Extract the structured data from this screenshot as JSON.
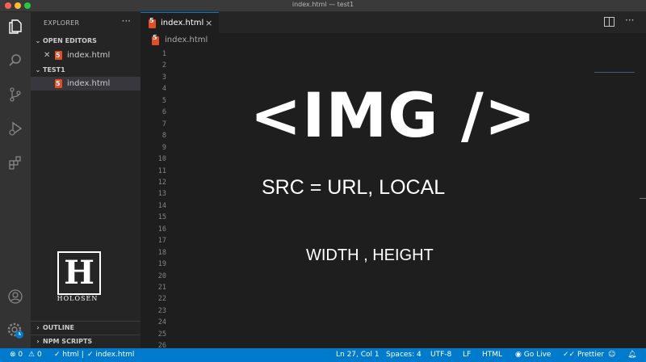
{
  "window": {
    "title": "index.html — test1"
  },
  "activity_bar": {
    "icons": [
      "explorer-icon",
      "search-icon",
      "source-control-icon",
      "run-debug-icon",
      "extensions-icon",
      "account-icon",
      "settings-gear-icon"
    ]
  },
  "sidebar": {
    "header": "EXPLORER",
    "more": "···",
    "open_editors": {
      "label": "OPEN EDITORS",
      "items": [
        {
          "label": "index.html"
        }
      ]
    },
    "workspace": {
      "label": "TEST1",
      "items": [
        {
          "label": "index.html"
        }
      ]
    },
    "logo_text": "HOLOSEN",
    "logo_letter": "H",
    "outline": "OUTLINE",
    "npm_scripts": "NPM SCRIPTS"
  },
  "tabs": [
    {
      "label": "index.html",
      "close": "×"
    }
  ],
  "breadcrumb": {
    "file": "index.html"
  },
  "editor": {
    "line_numbers": [
      "1",
      "2",
      "3",
      "4",
      "5",
      "6",
      "7",
      "8",
      "9",
      "10",
      "11",
      "12",
      "13",
      "14",
      "15",
      "16",
      "17",
      "18",
      "19",
      "20",
      "21",
      "22",
      "23",
      "24",
      "25",
      "26"
    ],
    "overlay": {
      "line1": "<IMG />",
      "line2": "SRC = URL, LOCAL",
      "line3": "WIDTH , HEIGHT"
    }
  },
  "status": {
    "errors": "0",
    "warnings": "0",
    "html_check": "html |",
    "file_check": "index.html",
    "position": "Ln 27, Col 1",
    "spaces": "Spaces: 4",
    "encoding": "UTF-8",
    "eol": "LF",
    "language": "HTML",
    "golive": "Go Live",
    "prettier": "Prettier"
  },
  "colors": {
    "accent": "#007acc",
    "html_icon": "#e44d26"
  }
}
